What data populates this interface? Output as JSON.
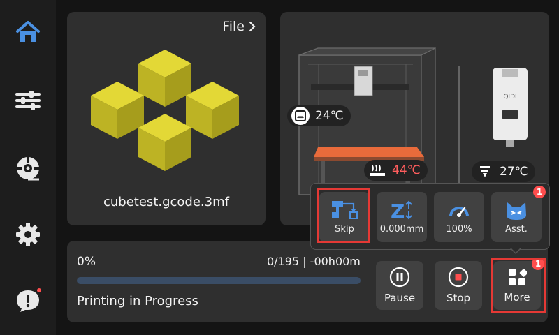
{
  "sidebar": {
    "items": [
      {
        "name": "home",
        "icon": "home-icon",
        "active": true
      },
      {
        "name": "tune",
        "icon": "sliders-icon"
      },
      {
        "name": "filament",
        "icon": "filament-spool-icon"
      },
      {
        "name": "settings",
        "icon": "gear-icon"
      },
      {
        "name": "support",
        "icon": "alert-chat-icon",
        "dot": true
      }
    ]
  },
  "file_panel": {
    "link_label": "File",
    "filename": "cubetest.gcode.3mf"
  },
  "printer": {
    "chamber_temp": "24℃",
    "bed_temp": "44℃",
    "nozzle_temp": "27℃",
    "brand_text": "QIDI"
  },
  "popup": {
    "buttons": [
      {
        "id": "skip",
        "label": "Skip",
        "icon": "skip-object-icon"
      },
      {
        "id": "z_offset",
        "label": "0.000mm",
        "icon": "z-offset-icon"
      },
      {
        "id": "speed",
        "label": "100%",
        "icon": "speedometer-icon"
      },
      {
        "id": "assistant",
        "label": "Asst.",
        "icon": "assistant-cat-icon",
        "badge": "1"
      }
    ]
  },
  "progress": {
    "percent_label": "0%",
    "percent_value": 0,
    "layers": "0/195 | -00h00m",
    "status": "Printing in Progress"
  },
  "controls": {
    "pause_label": "Pause",
    "stop_label": "Stop",
    "more_label": "More",
    "more_badge": "1"
  },
  "colors": {
    "accent": "#4a90e2",
    "cube": "#c9c02a",
    "hot": "#ff5d5d",
    "highlight": "#e53935"
  }
}
